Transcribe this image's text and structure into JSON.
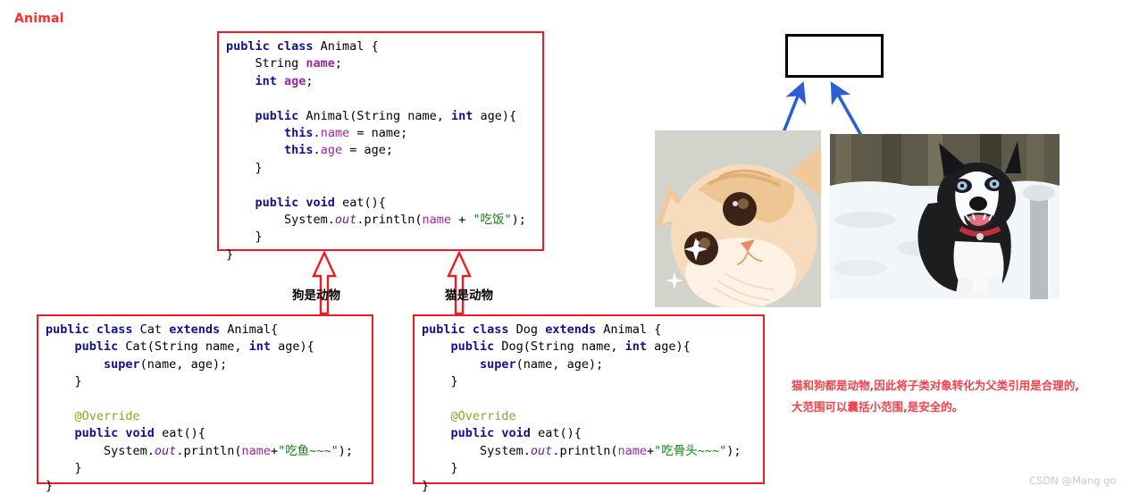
{
  "animal_class": {
    "title": "Animal",
    "lines": [
      [
        {
          "t": "public class ",
          "c": "kw"
        },
        {
          "t": "Animal {",
          "c": "plain"
        }
      ],
      [
        {
          "t": "    String ",
          "c": "plain"
        },
        {
          "t": "name",
          "c": "fld-b"
        },
        {
          "t": ";",
          "c": "plain"
        }
      ],
      [
        {
          "t": "    ",
          "c": "plain"
        },
        {
          "t": "int ",
          "c": "kw"
        },
        {
          "t": "age",
          "c": "fld-b"
        },
        {
          "t": ";",
          "c": "plain"
        }
      ],
      [
        {
          "t": "",
          "c": "plain"
        }
      ],
      [
        {
          "t": "    ",
          "c": "plain"
        },
        {
          "t": "public ",
          "c": "kw"
        },
        {
          "t": "Animal(String name, ",
          "c": "plain"
        },
        {
          "t": "int ",
          "c": "kw"
        },
        {
          "t": "age){",
          "c": "plain"
        }
      ],
      [
        {
          "t": "        ",
          "c": "plain"
        },
        {
          "t": "this",
          "c": "kw"
        },
        {
          "t": ".",
          "c": "plain"
        },
        {
          "t": "name",
          "c": "fld"
        },
        {
          "t": " = name;",
          "c": "plain"
        }
      ],
      [
        {
          "t": "        ",
          "c": "plain"
        },
        {
          "t": "this",
          "c": "kw"
        },
        {
          "t": ".",
          "c": "plain"
        },
        {
          "t": "age",
          "c": "fld"
        },
        {
          "t": " = age;",
          "c": "plain"
        }
      ],
      [
        {
          "t": "    }",
          "c": "plain"
        }
      ],
      [
        {
          "t": "",
          "c": "plain"
        }
      ],
      [
        {
          "t": "    ",
          "c": "plain"
        },
        {
          "t": "public void ",
          "c": "kw"
        },
        {
          "t": "eat(){",
          "c": "plain"
        }
      ],
      [
        {
          "t": "        System.",
          "c": "plain"
        },
        {
          "t": "out",
          "c": "ital"
        },
        {
          "t": ".println(",
          "c": "plain"
        },
        {
          "t": "name",
          "c": "fld"
        },
        {
          "t": " + ",
          "c": "plain"
        },
        {
          "t": "\"吃饭\"",
          "c": "str"
        },
        {
          "t": ");",
          "c": "plain"
        }
      ],
      [
        {
          "t": "    }",
          "c": "plain"
        }
      ],
      [
        {
          "t": "}",
          "c": "plain"
        }
      ]
    ]
  },
  "cat_class": {
    "title": "Cat",
    "lines": [
      [
        {
          "t": "public class ",
          "c": "kw"
        },
        {
          "t": "Cat ",
          "c": "plain"
        },
        {
          "t": "extends ",
          "c": "kw"
        },
        {
          "t": "Animal{",
          "c": "plain"
        }
      ],
      [
        {
          "t": "    ",
          "c": "plain"
        },
        {
          "t": "public ",
          "c": "kw"
        },
        {
          "t": "Cat(String name, ",
          "c": "plain"
        },
        {
          "t": "int ",
          "c": "kw"
        },
        {
          "t": "age){",
          "c": "plain"
        }
      ],
      [
        {
          "t": "        ",
          "c": "plain"
        },
        {
          "t": "super",
          "c": "kw"
        },
        {
          "t": "(name, age);",
          "c": "plain"
        }
      ],
      [
        {
          "t": "    }",
          "c": "plain"
        }
      ],
      [
        {
          "t": "",
          "c": "plain"
        }
      ],
      [
        {
          "t": "    ",
          "c": "plain"
        },
        {
          "t": "@Override",
          "c": "ann"
        }
      ],
      [
        {
          "t": "    ",
          "c": "plain"
        },
        {
          "t": "public void ",
          "c": "kw"
        },
        {
          "t": "eat(){",
          "c": "plain"
        }
      ],
      [
        {
          "t": "        System.",
          "c": "plain"
        },
        {
          "t": "out",
          "c": "ital"
        },
        {
          "t": ".println(",
          "c": "plain"
        },
        {
          "t": "name",
          "c": "fld"
        },
        {
          "t": "+",
          "c": "plain"
        },
        {
          "t": "\"吃鱼~~~\"",
          "c": "str"
        },
        {
          "t": ");",
          "c": "plain"
        }
      ],
      [
        {
          "t": "    }",
          "c": "plain"
        }
      ],
      [
        {
          "t": "}",
          "c": "plain"
        }
      ]
    ]
  },
  "dog_class": {
    "title": "Dog",
    "lines": [
      [
        {
          "t": "public class ",
          "c": "kw"
        },
        {
          "t": "Dog ",
          "c": "plain"
        },
        {
          "t": "extends ",
          "c": "kw"
        },
        {
          "t": "Animal {",
          "c": "plain"
        }
      ],
      [
        {
          "t": "    ",
          "c": "plain"
        },
        {
          "t": "public ",
          "c": "kw"
        },
        {
          "t": "Dog(String name, ",
          "c": "plain"
        },
        {
          "t": "int ",
          "c": "kw"
        },
        {
          "t": "age){",
          "c": "plain"
        }
      ],
      [
        {
          "t": "        ",
          "c": "plain"
        },
        {
          "t": "super",
          "c": "kw"
        },
        {
          "t": "(name, age);",
          "c": "plain"
        }
      ],
      [
        {
          "t": "    }",
          "c": "plain"
        }
      ],
      [
        {
          "t": "",
          "c": "plain"
        }
      ],
      [
        {
          "t": "    ",
          "c": "plain"
        },
        {
          "t": "@Override",
          "c": "ann"
        }
      ],
      [
        {
          "t": "    ",
          "c": "plain"
        },
        {
          "t": "public void ",
          "c": "kw"
        },
        {
          "t": "eat(){",
          "c": "plain"
        }
      ],
      [
        {
          "t": "        System.",
          "c": "plain"
        },
        {
          "t": "out",
          "c": "ital"
        },
        {
          "t": ".println(",
          "c": "plain"
        },
        {
          "t": "name",
          "c": "fld"
        },
        {
          "t": "+",
          "c": "plain"
        },
        {
          "t": "\"吃骨头~~~\"",
          "c": "str"
        },
        {
          "t": ");",
          "c": "plain"
        }
      ],
      [
        {
          "t": "    }",
          "c": "plain"
        }
      ],
      [
        {
          "t": "}",
          "c": "plain"
        }
      ]
    ]
  },
  "uml": {
    "label_left": "狗是动物",
    "label_right": "猫是动物",
    "arrow_color": "#ed1c24"
  },
  "diagram": {
    "parent_node_label": "Animal",
    "parent_node_text_color": "#ff2d2d",
    "arrow_color": "#2c5fd1"
  },
  "note": {
    "line1": "猫和狗都是动物,因此将子类对象转化为父类引用是合理的,",
    "line2": "大范围可以囊括小范围,是安全的。",
    "color": "#f7404a"
  },
  "watermark": {
    "text": "CSDN @Mang go"
  },
  "photos": {
    "cat_alt": "cat-photo",
    "dog_alt": "dog-photo"
  }
}
